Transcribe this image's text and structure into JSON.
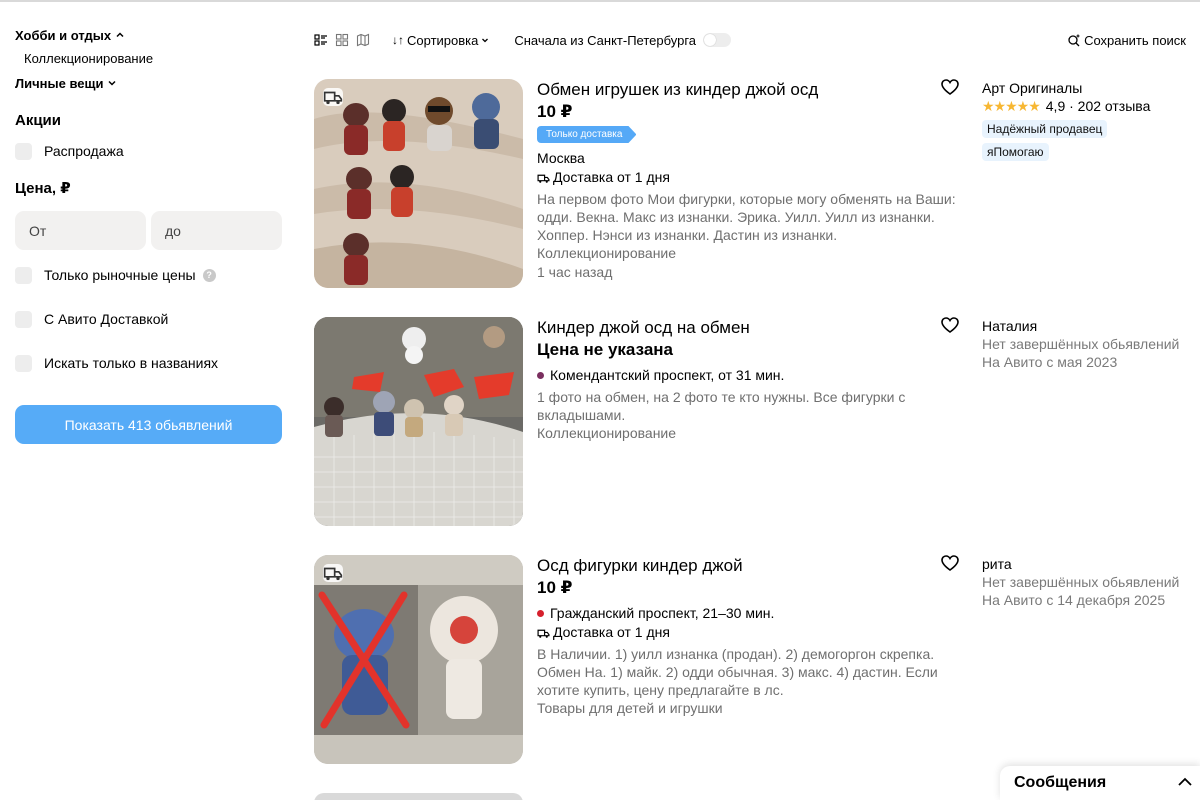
{
  "sidebar": {
    "category": "Хобби и отдых",
    "subcategory": "Коллекционирование",
    "personal": "Личные вещи",
    "promo_title": "Акции",
    "sale_label": "Распродажа",
    "price_title": "Цена, ₽",
    "price_from_placeholder": "От",
    "price_to_placeholder": "до",
    "market_price_label": "Только рыночные цены",
    "help_glyph": "?",
    "avito_delivery_label": "С Авито Доставкой",
    "titles_only_label": "Искать только в названиях",
    "show_button": "Показать 413 обьявлений"
  },
  "toolbar": {
    "sort_label": "Сортировка",
    "spb_label": "Сначала из Санкт-Петербурга",
    "spb_toggle_on": false,
    "save_search": "Сохранить поиск"
  },
  "listings": [
    {
      "title": "Обмен игрушек из киндер джой осд",
      "price": "10 ₽",
      "tag": "Только доставка",
      "location": "Москва",
      "delivery": "Доставка от 1 дня",
      "description": "На первом фото Мои фигурки, которые могу обменять на Ваши: одди. Векна. Макс из изнанки. Эрика. Уилл. Уилл из изнанки. Хоппер. Нэнси из изнанки. Дастин из изнанки.",
      "category": "Коллекционирование",
      "time": "1 час назад",
      "seller_name": "Арт Оригиналы",
      "stars": "★★★★★",
      "rating": "4,9 · 202 отзыва",
      "seller_badge_1": "Надёжный продавец",
      "seller_badge_2": "яПомогаю"
    },
    {
      "title": "Киндер джой осд на обмен",
      "price": "Цена не указана",
      "metro": "Комендантский проспект, от 31 мин.",
      "metro_color": "#7a2f5f",
      "description": "1 фото на обмен, на 2 фото те кто нужны. Все фигурки с вкладышами.",
      "category": "Коллекционирование",
      "seller_name": "Наталия",
      "seller_line_1": "Нет завершённых обьявлений",
      "seller_line_2": "На Авито с мая 2023"
    },
    {
      "title": "Осд фигурки киндер джой",
      "price": "10 ₽",
      "metro": "Гражданский проспект, 21–30 мин.",
      "metro_color": "#d6202d",
      "delivery": "Доставка от 1 дня",
      "description": "В Наличии. 1) уилл изнанка (продан). 2) демогоргон скрепка. Обмен На. 1) майк. 2) одди обычная. 3) макс. 4) дастин. Если хотите купить, цену предлагайте в лс.",
      "category": "Товары для детей и игрушки",
      "seller_name": "рита",
      "seller_line_1": "Нет завершённых обьявлений",
      "seller_line_2": "На Авито с 14 декабря 2025"
    }
  ],
  "messages_label": "Сообщения",
  "colors": {
    "accent": "#56abf7",
    "star": "#f7b733",
    "badge_bg": "#e8f3fd"
  }
}
